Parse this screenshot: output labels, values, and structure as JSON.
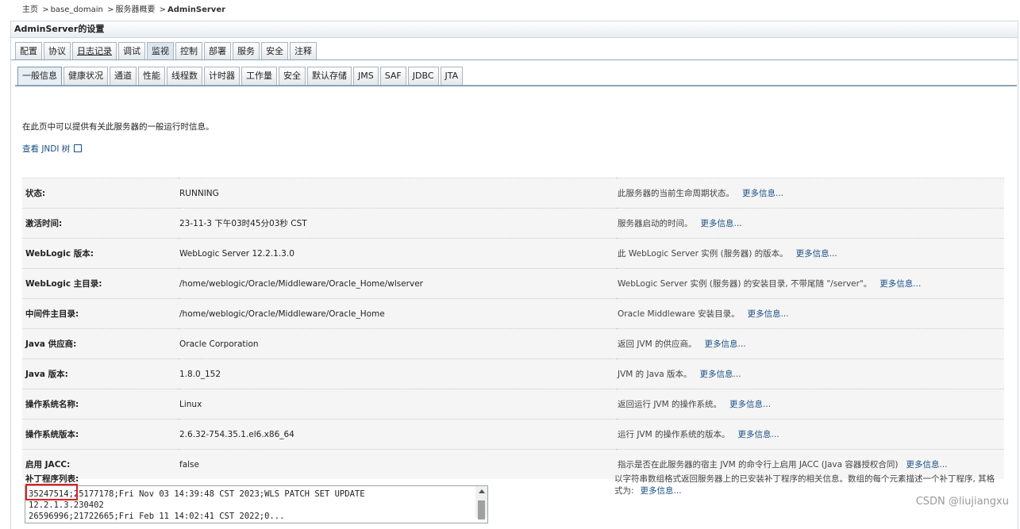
{
  "breadcrumb": {
    "home": "主页",
    "domain": "base_domain",
    "overview": "服务器概要",
    "current": "AdminServer",
    "sep": ">"
  },
  "panel_title": "AdminServer的设置",
  "main_tabs": [
    {
      "label": "配置",
      "active": false,
      "u": false
    },
    {
      "label": "协议",
      "active": false,
      "u": false
    },
    {
      "label": "日志记录",
      "active": false,
      "u": true
    },
    {
      "label": "调试",
      "active": false,
      "u": false
    },
    {
      "label": "监视",
      "active": true,
      "u": false
    },
    {
      "label": "控制",
      "active": false,
      "u": false
    },
    {
      "label": "部署",
      "active": false,
      "u": false
    },
    {
      "label": "服务",
      "active": false,
      "u": false
    },
    {
      "label": "安全",
      "active": false,
      "u": false
    },
    {
      "label": "注释",
      "active": false,
      "u": false
    }
  ],
  "sub_tabs": [
    {
      "label": "一般信息",
      "active": true
    },
    {
      "label": "健康状况",
      "active": false
    },
    {
      "label": "通道",
      "active": false
    },
    {
      "label": "性能",
      "active": false
    },
    {
      "label": "线程数",
      "active": false
    },
    {
      "label": "计时器",
      "active": false
    },
    {
      "label": "工作量",
      "active": false
    },
    {
      "label": "安全",
      "active": false
    },
    {
      "label": "默认存储",
      "active": false
    },
    {
      "label": "JMS",
      "active": false
    },
    {
      "label": "SAF",
      "active": false
    },
    {
      "label": "JDBC",
      "active": false
    },
    {
      "label": "JTA",
      "active": false
    }
  ],
  "intro": "在此页中可以提供有关此服务器的一般运行时信息。",
  "jndi_link": "查看 JNDI 树",
  "more_info": "更多信息...",
  "rows": [
    {
      "label": "状态:",
      "value": "RUNNING",
      "desc": "此服务器的当前生命周期状态。"
    },
    {
      "label": "激活时间:",
      "value": "23-11-3 下午03时45分03秒 CST",
      "desc": "服务器启动的时间。"
    },
    {
      "label": "WebLogic 版本:",
      "value": "WebLogic Server 12.2.1.3.0",
      "desc": "此 WebLogic Server 实例 (服务器) 的版本。"
    },
    {
      "label": "WebLogic 主目录:",
      "value": "/home/weblogic/Oracle/Middleware/Oracle_Home/wlserver",
      "desc": "WebLogic Server 实例 (服务器) 的安装目录, 不带尾随 \"/server\"。"
    },
    {
      "label": "中间件主目录:",
      "value": "/home/weblogic/Oracle/Middleware/Oracle_Home",
      "desc": "Oracle Middleware 安装目录。"
    },
    {
      "label": "Java 供应商:",
      "value": "Oracle Corporation",
      "desc": "返回 JVM 的供应商。"
    },
    {
      "label": "Java 版本:",
      "value": "1.8.0_152",
      "desc": "JVM 的 Java 版本。"
    },
    {
      "label": "操作系统名称:",
      "value": "Linux",
      "desc": "返回运行 JVM 的操作系统。"
    },
    {
      "label": "操作系统版本:",
      "value": "2.6.32-754.35.1.el6.x86_64",
      "desc": "运行 JVM 的操作系统的版本。"
    },
    {
      "label": "启用 JACC:",
      "value": "false",
      "desc": "指示是否在此服务器的宿主 JVM 的命令行上启用 JACC (Java 容器授权合同)"
    }
  ],
  "patch": {
    "label": "补丁程序列表:",
    "desc": "以字符串数组格式返回服务器上的已安装补丁程序的相关信息。数组的每个元素描述一个补丁程序, 其格式为:",
    "text": "35247514;25177178;Fri Nov 03 14:39:48 CST 2023;WLS PATCH SET UPDATE\n12.2.1.3.230402\n26596996;21722665;Fri Feb 11 14:02:41 CST 2022;0..."
  },
  "watermark": "CSDN @liujiangxu"
}
